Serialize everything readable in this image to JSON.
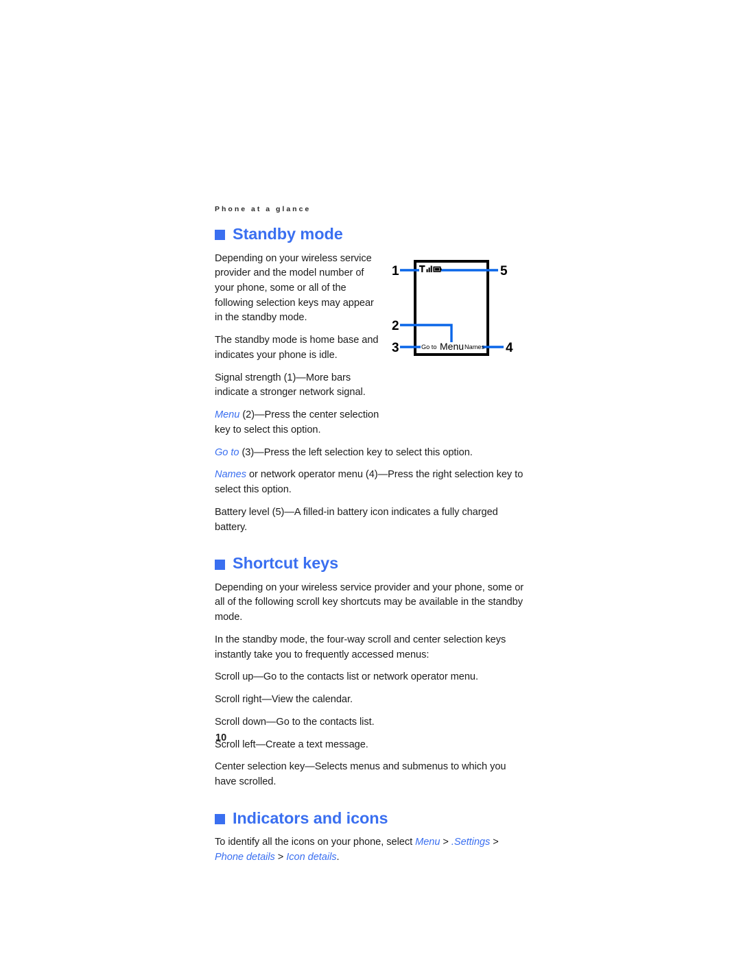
{
  "page": {
    "running_header": "Phone at a glance",
    "folio": "10",
    "accent_color": "#3a6ff0",
    "text_color": "#1b1b1b",
    "background_color": "#ffffff"
  },
  "sections": [
    {
      "id": "standby-mode",
      "heading": "Standby mode",
      "paragraphs": [
        {
          "id": "standby-p1",
          "width": "narrow",
          "text": "Depending on your wireless service provider and the model number of your phone, some or all of the following selection keys may appear in the standby mode."
        },
        {
          "id": "standby-p2",
          "width": "narrow",
          "text": "The standby mode is home base and indicates your phone is idle."
        },
        {
          "id": "standby-p3",
          "width": "narrow",
          "text": "Signal strength (1)—More bars indicate a stronger network signal."
        }
      ],
      "rich_paragraphs": [
        {
          "id": "standby-menu",
          "width": "narrow",
          "term": "Menu",
          "rest": " (2)—Press the center selection key to select this option."
        },
        {
          "id": "standby-goto",
          "width": "wide",
          "term": "Go to",
          "rest": " (3)—Press the left selection key to select this option."
        },
        {
          "id": "standby-names",
          "width": "wide",
          "term": "Names",
          "rest": " or network operator menu (4)—Press the right selection key to select this option."
        }
      ],
      "final_paragraph": {
        "id": "standby-battery",
        "width": "wide",
        "text": "Battery level (5)—A filled-in battery icon indicates a fully charged battery."
      }
    },
    {
      "id": "shortcut-keys",
      "heading": "Shortcut keys",
      "paragraphs": [
        {
          "id": "shortcut-p1",
          "width": "wide",
          "text": "Depending on your wireless service provider and your phone, some or all of the following scroll key shortcuts may be available in the standby mode."
        },
        {
          "id": "shortcut-p2",
          "width": "wide",
          "text": "In the standby mode, the four-way scroll and center selection keys instantly take you to frequently accessed menus:"
        }
      ],
      "list": [
        "Scroll up—Go to the contacts list or network operator menu.",
        "Scroll right—View the calendar.",
        "Scroll down—Go to the contacts list.",
        "Scroll left—Create a text message.",
        "Center selection key—Selects menus and submenus to which you have scrolled."
      ]
    },
    {
      "id": "indicators-and-icons",
      "heading": "Indicators and icons",
      "path_paragraph": {
        "lead": "To identify all the icons on your phone, select ",
        "crumbs": [
          "Menu",
          ".Settings",
          "Phone details",
          "Icon details"
        ],
        "separator": " > ",
        "trailing": "."
      }
    }
  ],
  "figure": {
    "name": "standby-screen-diagram",
    "callouts": [
      {
        "number": "1",
        "target": "signal-strength-indicator",
        "side": "left",
        "row": "top"
      },
      {
        "number": "2",
        "target": "menu-softkey",
        "side": "left",
        "row": "middle"
      },
      {
        "number": "3",
        "target": "go-to-softkey",
        "side": "left",
        "row": "bottom"
      },
      {
        "number": "4",
        "target": "names-softkey",
        "side": "right",
        "row": "bottom"
      },
      {
        "number": "5",
        "target": "battery-level-indicator",
        "side": "right",
        "row": "top"
      }
    ],
    "status_bar": {
      "antenna_icon": "antenna-icon",
      "signal_bars": 3,
      "battery_icon": "battery-full-icon"
    },
    "softkeys": {
      "left": "Go to",
      "center": "Menu",
      "right": "Names"
    },
    "line_color": "#0a66e8",
    "frame_color": "#000000"
  }
}
